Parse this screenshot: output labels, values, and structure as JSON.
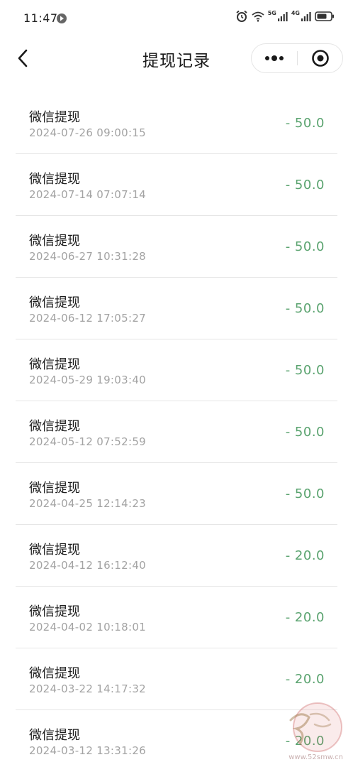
{
  "status_bar": {
    "time": "11:47",
    "network_5g": "5G",
    "network_4g": "4G"
  },
  "navbar": {
    "title": "提现记录"
  },
  "records": [
    {
      "title": "微信提现",
      "time": "2024-07-26 09:00:15",
      "amount": "- 50.0"
    },
    {
      "title": "微信提现",
      "time": "2024-07-14 07:07:14",
      "amount": "- 50.0"
    },
    {
      "title": "微信提现",
      "time": "2024-06-27 10:31:28",
      "amount": "- 50.0"
    },
    {
      "title": "微信提现",
      "time": "2024-06-12 17:05:27",
      "amount": "- 50.0"
    },
    {
      "title": "微信提现",
      "time": "2024-05-29 19:03:40",
      "amount": "- 50.0"
    },
    {
      "title": "微信提现",
      "time": "2024-05-12 07:52:59",
      "amount": "- 50.0"
    },
    {
      "title": "微信提现",
      "time": "2024-04-25 12:14:23",
      "amount": "- 50.0"
    },
    {
      "title": "微信提现",
      "time": "2024-04-12 16:12:40",
      "amount": "- 20.0"
    },
    {
      "title": "微信提现",
      "time": "2024-04-02 10:18:01",
      "amount": "- 20.0"
    },
    {
      "title": "微信提现",
      "time": "2024-03-22 14:17:32",
      "amount": "- 20.0"
    },
    {
      "title": "微信提现",
      "time": "2024-03-12 13:31:26",
      "amount": "- 20.0"
    }
  ],
  "watermark": {
    "text": "www.52smw.cn"
  },
  "colors": {
    "amount": "#5aa36f",
    "timestamp": "#a3a3a3",
    "divider": "#e6e6e6"
  },
  "icons": {
    "back": "chevron-left-icon",
    "more": "more-dots-icon",
    "close": "target-close-icon"
  }
}
